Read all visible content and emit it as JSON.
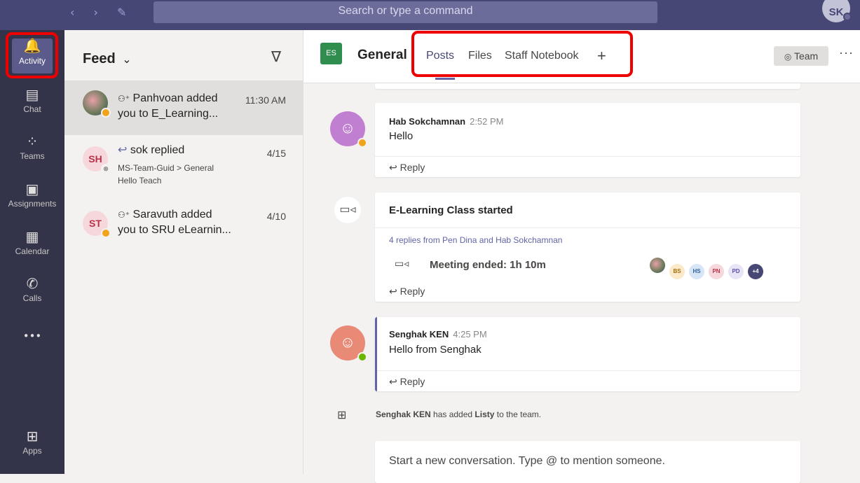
{
  "topbar": {
    "back_icon": "‹",
    "forward_icon": "›",
    "compose_icon": "compose-icon",
    "search_placeholder": "Search or type a command",
    "profile_initials": "SK"
  },
  "rail": [
    {
      "label": "Activity",
      "icon": "bell-icon",
      "glyph": "🔔"
    },
    {
      "label": "Chat",
      "icon": "chat-icon",
      "glyph": "▤"
    },
    {
      "label": "Teams",
      "icon": "teams-icon",
      "glyph": "⁘"
    },
    {
      "label": "Assignments",
      "icon": "assignments-icon",
      "glyph": "▣"
    },
    {
      "label": "Calendar",
      "icon": "calendar-icon",
      "glyph": "▦"
    },
    {
      "label": "Calls",
      "icon": "phone-icon",
      "glyph": "✆"
    },
    {
      "label": "",
      "icon": "more-apps-icon",
      "glyph": "•••"
    },
    {
      "label": "Apps",
      "icon": "apps-icon",
      "glyph": "⊞"
    }
  ],
  "feed": {
    "title": "Feed",
    "chevron": "⌄",
    "filter_icon": "∇",
    "items": [
      {
        "initials": "",
        "line1": "Panhvoan added",
        "line2": "you to E_Learning...",
        "time": "11:30 AM",
        "sub": "",
        "sub2": ""
      },
      {
        "initials": "SH",
        "line1": "sok replied",
        "line2": "",
        "time": "4/15",
        "sub": "MS-Team-Guid > General",
        "sub2": "Hello Teach"
      },
      {
        "initials": "ST",
        "line1": "Saravuth added",
        "line2": "you to SRU eLearnin...",
        "time": "4/10",
        "sub": "",
        "sub2": ""
      }
    ]
  },
  "channel": {
    "badge": "ES",
    "name": "General",
    "tabs": [
      "Posts",
      "Files",
      "Staff Notebook"
    ],
    "add_tab": "+",
    "team_button": "Team",
    "more": "···"
  },
  "posts": [
    {
      "author": "Hab Sokchamnan",
      "time": "2:52 PM",
      "body": "Hello",
      "reply": "Reply"
    },
    {
      "title": "E-Learning Class started",
      "replies_link": "4 replies from Pen Dina and Hab Sokchamnan",
      "meeting": "Meeting ended: 1h 10m",
      "participants": [
        "BS",
        "HS",
        "PN",
        "PD",
        "+4"
      ],
      "reply": "Reply"
    },
    {
      "author": "Senghak KEN",
      "time": "4:25 PM",
      "body": "Hello from Senghak",
      "reply": "Reply"
    }
  ],
  "system_message": {
    "actor": "Senghak KEN",
    "middle": " has added ",
    "app": "Listy",
    "end": " to the team."
  },
  "compose_placeholder": "Start a new conversation. Type @ to mention someone.",
  "colors": {
    "brand": "#464775",
    "rail": "#33344a",
    "highlight": "#ee0000",
    "accent": "#6264a7"
  }
}
